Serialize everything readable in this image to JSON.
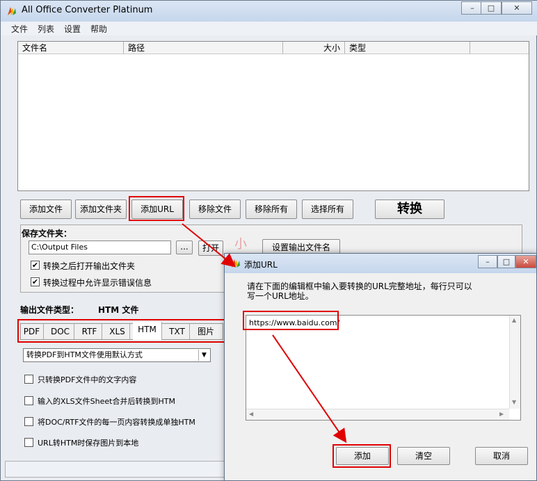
{
  "window": {
    "title": "All Office Converter Platinum",
    "min": "–",
    "max": "□",
    "close": "✕"
  },
  "menu": [
    "文件",
    "列表",
    "设置",
    "帮助"
  ],
  "list_columns": [
    "文件名",
    "路径",
    "大小",
    "类型"
  ],
  "buttons": {
    "add_file": "添加文件",
    "add_folder": "添加文件夹",
    "add_url": "添加URL",
    "remove_file": "移除文件",
    "remove_all": "移除所有",
    "select_all": "选择所有",
    "convert": "转换"
  },
  "save_folder": {
    "label": "保存文件夹：",
    "path": "C:\\Output Files",
    "browse": "...",
    "open": "打开",
    "set_name": "设置输出文件名",
    "opt_open_after": "转换之后打开输出文件夹",
    "opt_show_errors": "转换过程中允许显示错误信息",
    "check": "✔"
  },
  "output": {
    "label": "输出文件类型：",
    "value": "HTM 文件",
    "tabs": [
      "PDF",
      "DOC",
      "RTF",
      "XLS",
      "HTM",
      "TXT",
      "图片"
    ],
    "method": "转换PDF到HTM文件使用默认方式",
    "dropdown_arrow": "▼",
    "options": [
      "只转换PDF文件中的文字内容",
      "输入的XLS文件Sheet合并后转换到HTM",
      "将DOC/RTF文件的每一页内容转换成单独HTM",
      "URL转HTM时保存图片到本地"
    ]
  },
  "watermark": "小",
  "dialog": {
    "title": "添加URL",
    "instruction_1": "请在下面的编辑框中输入要转换的URL完整地址，每行只可以",
    "instruction_2": "写一个URL地址。",
    "url_text": "https://www.baidu.com/",
    "add": "添加",
    "clear": "清空",
    "cancel": "取消",
    "min": "–",
    "max": "□",
    "close": "✕",
    "scroll_up": "▲",
    "scroll_down": "▼",
    "scroll_left": "◀",
    "scroll_right": "▶"
  },
  "colors": {
    "highlight": "#e00000",
    "titlebar": "#c5d6ec"
  }
}
